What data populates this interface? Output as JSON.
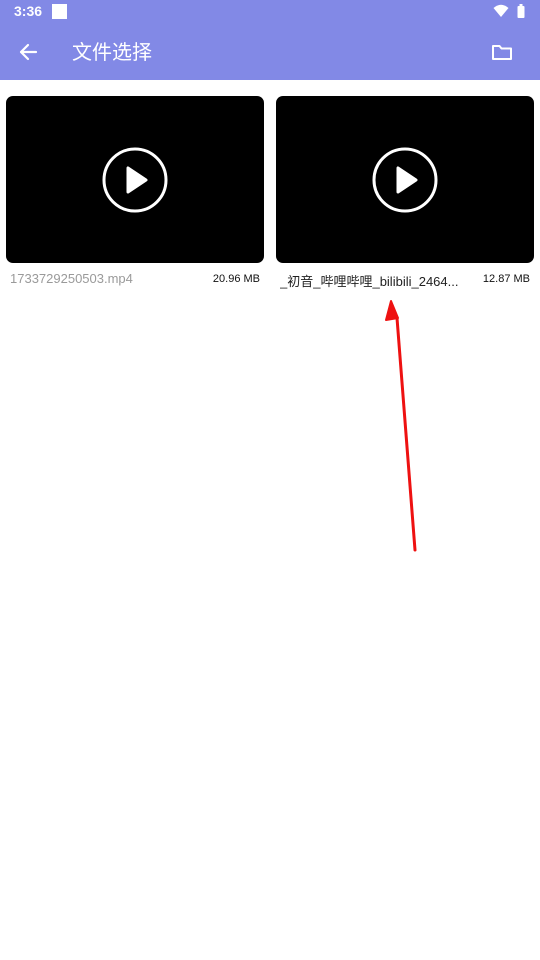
{
  "status_bar": {
    "time": "3:36",
    "icons": [
      "notification-square-icon",
      "wifi-icon",
      "battery-icon"
    ]
  },
  "app_bar": {
    "title": "文件选择",
    "back_icon": "back-arrow-icon",
    "folder_icon": "folder-icon",
    "background": "#8289e6"
  },
  "files": [
    {
      "name": "1733729250503.mp4",
      "size": "20.96 MB",
      "thumbnail": "black video thumbnail with play icon"
    },
    {
      "name": "_初音_哔哩哔哩_bilibili_2464...",
      "size": "12.87 MB",
      "thumbnail": "black video thumbnail with play icon"
    }
  ],
  "annotation": {
    "color": "#ee1111",
    "icon": "red-arrow-annotation"
  }
}
